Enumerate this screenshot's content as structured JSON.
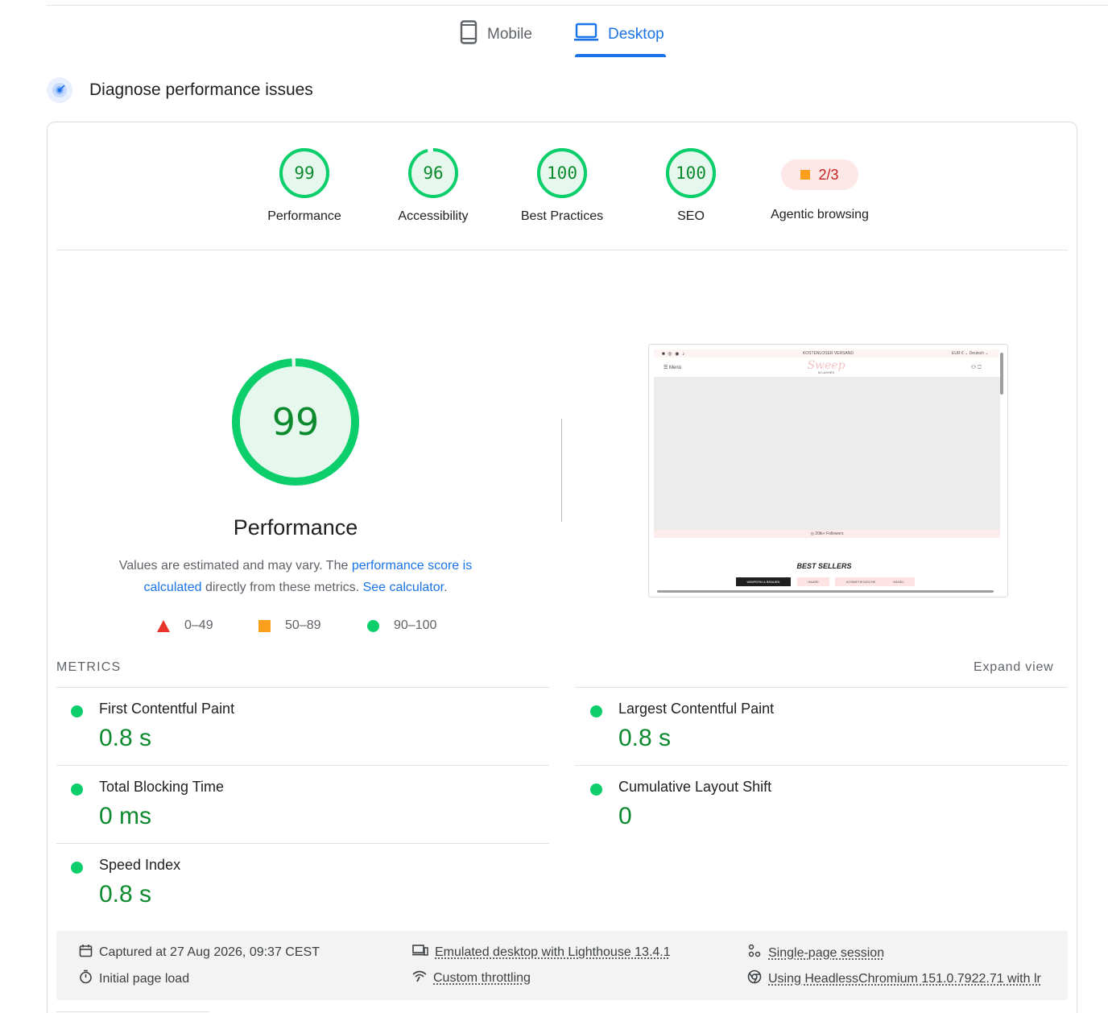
{
  "tabs": {
    "mobile": {
      "label": "Mobile",
      "icon": "smartphone-icon"
    },
    "desktop": {
      "label": "Desktop",
      "icon": "laptop-icon",
      "selected": true
    }
  },
  "section": {
    "title": "Diagnose performance issues",
    "icon": "speedometer-icon"
  },
  "scores": [
    {
      "value": "99",
      "label": "Performance",
      "fraction": 0.99
    },
    {
      "value": "96",
      "label": "Accessibility",
      "fraction": 0.96
    },
    {
      "value": "100",
      "label": "Best Practices",
      "fraction": 1.0
    },
    {
      "value": "100",
      "label": "SEO",
      "fraction": 1.0
    }
  ],
  "agentic": {
    "value": "2/3",
    "label": "Agentic browsing"
  },
  "performance": {
    "score": "99",
    "fraction": 0.99,
    "title": "Performance",
    "desc_prefix": "Values are estimated and may vary. The ",
    "desc_link1": "performance score is calculated",
    "desc_middle": " directly from these metrics. ",
    "desc_link2": "See calculator",
    "desc_suffix": "."
  },
  "legend": {
    "fail": "0–49",
    "average": "50–89",
    "pass": "90–100"
  },
  "screenshot": {
    "shipping": "KOSTENLOSER VERSAND",
    "currency": "EUR € ⌄   Deutsch ⌄",
    "menu": "☰ Menü",
    "logo": "Sweep",
    "logo_sub": "M LASHES",
    "followers": "◎ 20tk+ Followers",
    "best_sellers": "BEST SELLERS",
    "pills": [
      "WIMPERN & BRAUEN",
      "HAARE",
      "KOSMETIKTASCHE",
      "NÄGEL"
    ]
  },
  "metrics": {
    "heading": "METRICS",
    "expand": "Expand view",
    "items": [
      {
        "name": "First Contentful Paint",
        "value": "0.8 s"
      },
      {
        "name": "Largest Contentful Paint",
        "value": "0.8 s"
      },
      {
        "name": "Total Blocking Time",
        "value": "0 ms"
      },
      {
        "name": "Cumulative Layout Shift",
        "value": "0"
      },
      {
        "name": "Speed Index",
        "value": "0.8 s"
      }
    ]
  },
  "footer": {
    "captured": "Captured at 27 Aug 2026, 09:37 CEST",
    "load": "Initial page load",
    "emulated": "Emulated desktop with Lighthouse 13.4.1",
    "throttling": "Custom throttling",
    "session": "Single-page session",
    "browser": "Using HeadlessChromium 151.0.7922.71 with lr"
  },
  "colors": {
    "pass": "#0cce6b",
    "pass_text": "#0d8a2e",
    "average": "#fa9f1b",
    "fail": "#e8352b",
    "accent": "#1a73e8"
  }
}
